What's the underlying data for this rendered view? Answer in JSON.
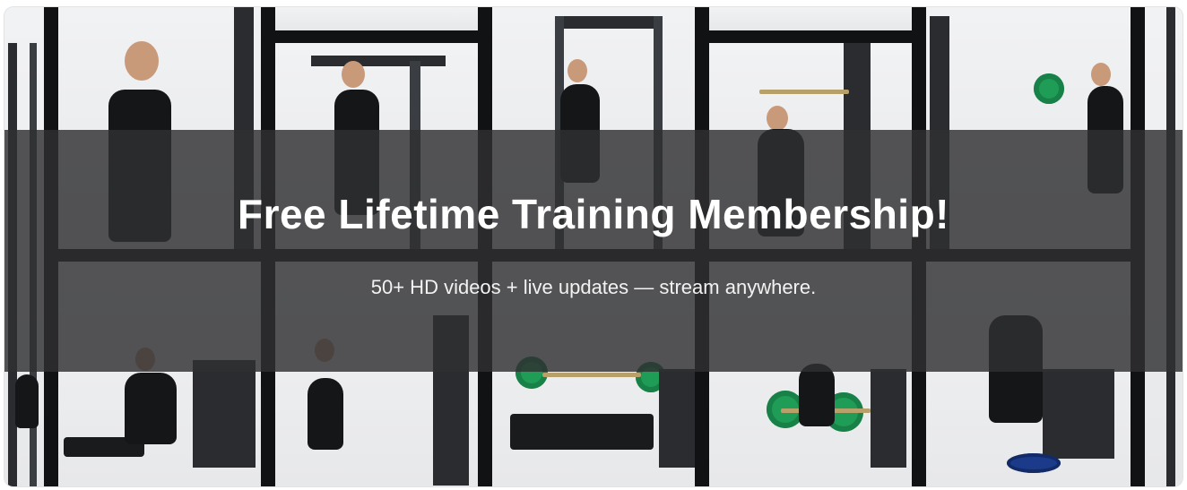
{
  "banner": {
    "headline": "Free Lifetime Training Membership!",
    "subline": "50+ HD videos + live updates — stream anywhere.",
    "background_description_icons": [
      "exercise-video-thumbnail-grid"
    ],
    "overlay_color": "#303032"
  }
}
